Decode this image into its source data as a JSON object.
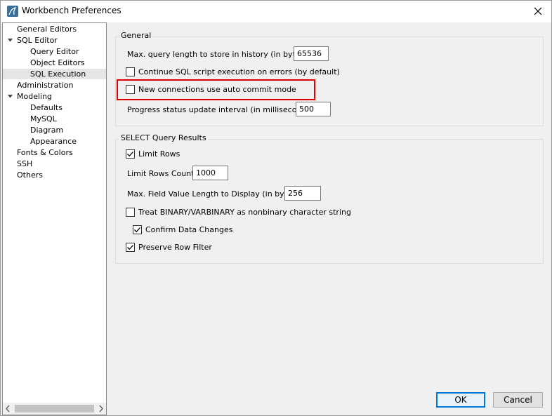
{
  "window": {
    "title": "Workbench Preferences"
  },
  "sidebar": {
    "items": [
      {
        "label": "General Editors",
        "level": 0,
        "expander": "none"
      },
      {
        "label": "SQL Editor",
        "level": 0,
        "expander": "expanded"
      },
      {
        "label": "Query Editor",
        "level": 1,
        "expander": "none"
      },
      {
        "label": "Object Editors",
        "level": 1,
        "expander": "none"
      },
      {
        "label": "SQL Execution",
        "level": 1,
        "expander": "none",
        "selected": true
      },
      {
        "label": "Administration",
        "level": 0,
        "expander": "none"
      },
      {
        "label": "Modeling",
        "level": 0,
        "expander": "expanded"
      },
      {
        "label": "Defaults",
        "level": 1,
        "expander": "none"
      },
      {
        "label": "MySQL",
        "level": 1,
        "expander": "none"
      },
      {
        "label": "Diagram",
        "level": 1,
        "expander": "none"
      },
      {
        "label": "Appearance",
        "level": 1,
        "expander": "none"
      },
      {
        "label": "Fonts & Colors",
        "level": 0,
        "expander": "none"
      },
      {
        "label": "SSH",
        "level": 0,
        "expander": "none"
      },
      {
        "label": "Others",
        "level": 0,
        "expander": "none"
      }
    ]
  },
  "general": {
    "title": "General",
    "max_query_length_label": "Max. query length to store in history (in bytes):",
    "max_query_length_value": "65536",
    "continue_on_errors_label": "Continue SQL script execution on errors (by default)",
    "continue_on_errors_checked": false,
    "auto_commit_label": "New connections use auto commit mode",
    "auto_commit_checked": false,
    "progress_interval_label": "Progress status update interval (in milliseconds):",
    "progress_interval_value": "500"
  },
  "select_results": {
    "title": "SELECT Query Results",
    "limit_rows_label": "Limit Rows",
    "limit_rows_checked": true,
    "limit_rows_count_label": "Limit Rows Count:",
    "limit_rows_count_value": "1000",
    "max_field_length_label": "Max. Field Value Length to Display (in bytes):",
    "max_field_length_value": "256",
    "treat_binary_label": "Treat BINARY/VARBINARY as nonbinary character string",
    "treat_binary_checked": false,
    "confirm_changes_label": "Confirm Data Changes",
    "confirm_changes_checked": true,
    "preserve_filter_label": "Preserve Row Filter",
    "preserve_filter_checked": true
  },
  "buttons": {
    "ok": "OK",
    "cancel": "Cancel"
  },
  "colors": {
    "highlight": "#e00000",
    "primary_button_border": "#0078d7",
    "selection": "#e5e5e5"
  },
  "icons": {
    "app": "mysql-workbench-dolphin-icon",
    "close": "close-icon",
    "expander": "chevron-down-icon",
    "check": "checkmark-icon"
  }
}
